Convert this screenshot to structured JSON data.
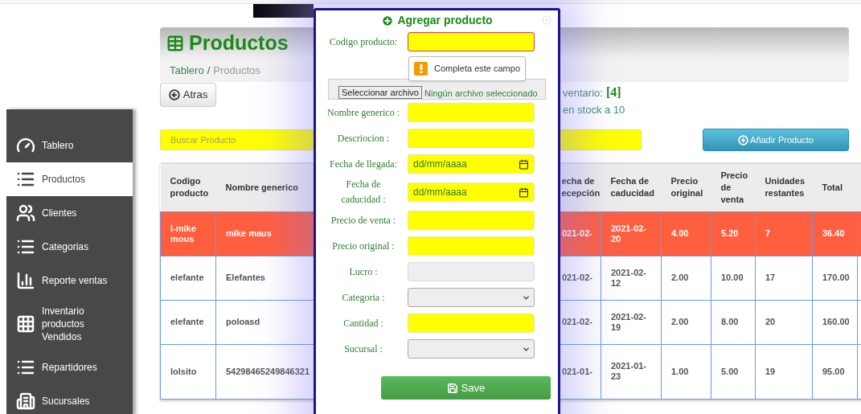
{
  "sidebar": {
    "items": [
      {
        "label": "Tablero",
        "selected": false
      },
      {
        "label": "Productos",
        "selected": true
      },
      {
        "label": "Clientes",
        "selected": false
      },
      {
        "label": "Categorias",
        "selected": false
      },
      {
        "label": "Reporte ventas",
        "selected": false
      },
      {
        "label": "Inventario productos Vendidos",
        "selected": false
      },
      {
        "label": "Repartidores",
        "selected": false
      },
      {
        "label": "Sucursales",
        "selected": false
      }
    ]
  },
  "page": {
    "title": "Productos",
    "breadcrumb": {
      "link": "Tablero",
      "separator": "/",
      "current": "Productos"
    },
    "back_button": "Atras",
    "inventory_label": "ventario:",
    "inventory_count": "[4]",
    "stock_text": "en stock a 10",
    "search": {
      "placeholder": "Buscar Producto"
    },
    "add_button": "Añadir Producto"
  },
  "table": {
    "columns": [
      "Codigo producto",
      "Nombre generico",
      "echa de ecepción",
      "Fecha de caducidad",
      "Precio original",
      "Precio de venta",
      "Unidades restantes",
      "Total"
    ],
    "rows": [
      {
        "highlighted": true,
        "cells": [
          "l-mike mous",
          "mike maus",
          "021-02-",
          "2021-02-20",
          "4.00",
          "5.20",
          "7",
          "36.40"
        ]
      },
      {
        "highlighted": false,
        "cells": [
          "elefante",
          "Elefantes",
          "021-02-",
          "2021-02-12",
          "2.00",
          "10.00",
          "17",
          "170.00"
        ]
      },
      {
        "highlighted": false,
        "cells": [
          "elefante",
          "poloasd",
          "021-02-",
          "2021-02-19",
          "2.00",
          "8.00",
          "20",
          "160.00"
        ]
      },
      {
        "highlighted": false,
        "cells": [
          "lolsito",
          "54298465249846321",
          "021-01-",
          "2021-01-23",
          "1.00",
          "5.00",
          "19",
          "95.00"
        ]
      }
    ]
  },
  "modal": {
    "title": "Agregar producto",
    "fields": [
      {
        "kind": "text",
        "label": "Codigo producto:",
        "focused": true,
        "error": "Completa este campo"
      },
      {
        "kind": "file",
        "button": "Seleccionar archivo",
        "status": "Ningún archivo seleccionado"
      },
      {
        "kind": "text",
        "label": "Nombre generico :",
        "focused": false
      },
      {
        "kind": "text",
        "label": "Descriocion :",
        "focused": false
      },
      {
        "kind": "date",
        "label": "Fecha de llegada:",
        "placeholder": "dd/mm/aaaa"
      },
      {
        "kind": "date",
        "label": "Fecha de caducidad :",
        "placeholder": "dd/mm/aaaa"
      },
      {
        "kind": "text",
        "label": "Precio de venta :",
        "focused": false
      },
      {
        "kind": "text",
        "label": "Precio original :",
        "focused": false
      },
      {
        "kind": "readonly",
        "label": "Lucro :"
      },
      {
        "kind": "select",
        "label": "Categoria :"
      },
      {
        "kind": "text",
        "label": "Cantidad :",
        "focused": false
      },
      {
        "kind": "select",
        "label": "Sucursal :"
      }
    ],
    "save_button": "Save"
  }
}
